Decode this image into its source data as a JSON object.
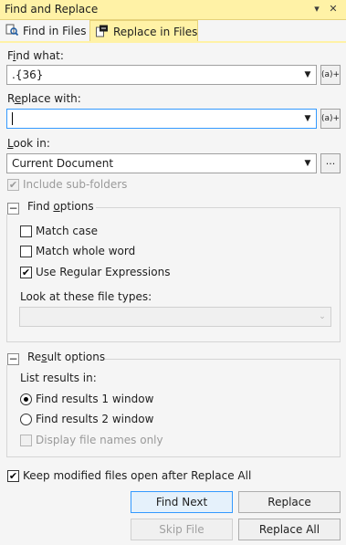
{
  "window": {
    "title": "Find and Replace",
    "pin_glyph": "▾",
    "close_glyph": "✕"
  },
  "tabs": [
    {
      "label": "Find in Files",
      "icon": "find-in-files-icon",
      "active": false
    },
    {
      "label": "Replace in Files",
      "icon": "replace-in-files-icon",
      "active": true
    }
  ],
  "find_what": {
    "label_pre": "F",
    "label_ul": "i",
    "label_post": "nd what:",
    "value": ".{36}",
    "regex_builder_label": "(a)+"
  },
  "replace_with": {
    "label_pre": "R",
    "label_ul": "e",
    "label_post": "place with:",
    "value": "",
    "regex_builder_label": "(a)+"
  },
  "look_in": {
    "label_pre": "",
    "label_ul": "L",
    "label_post": "ook in:",
    "value": "Current Document",
    "browse_label": "...",
    "include_subfolders_label": "Include sub-folders",
    "include_subfolders_checked": true,
    "include_subfolders_enabled": false
  },
  "find_options": {
    "header_pre": "Find ",
    "header_ul": "o",
    "header_post": "ptions",
    "collapse_glyph": "−",
    "match_case": {
      "label": "Match case",
      "checked": false
    },
    "match_whole_word": {
      "label": "Match whole word",
      "checked": false
    },
    "use_regex": {
      "label": "Use Regular Expressions",
      "checked": true
    },
    "file_types_label": "Look at these file types:",
    "file_types_value": ""
  },
  "result_options": {
    "header_pre": "Re",
    "header_ul": "s",
    "header_post": "ult options",
    "collapse_glyph": "−",
    "list_results_label": "List results in:",
    "window1": {
      "label": "Find results 1 window",
      "selected": true
    },
    "window2": {
      "label": "Find results 2 window",
      "selected": false
    },
    "display_file_names": {
      "label": "Display file names only",
      "checked": false,
      "enabled": false
    }
  },
  "keep_modified": {
    "label": "Keep modified files open after Replace All",
    "checked": true
  },
  "buttons": {
    "find_next": "Find Next",
    "replace": "Replace",
    "skip_file": "Skip File",
    "replace_all": "Replace All"
  },
  "colors": {
    "accent": "#fff2a6",
    "focus": "#3399ff"
  }
}
